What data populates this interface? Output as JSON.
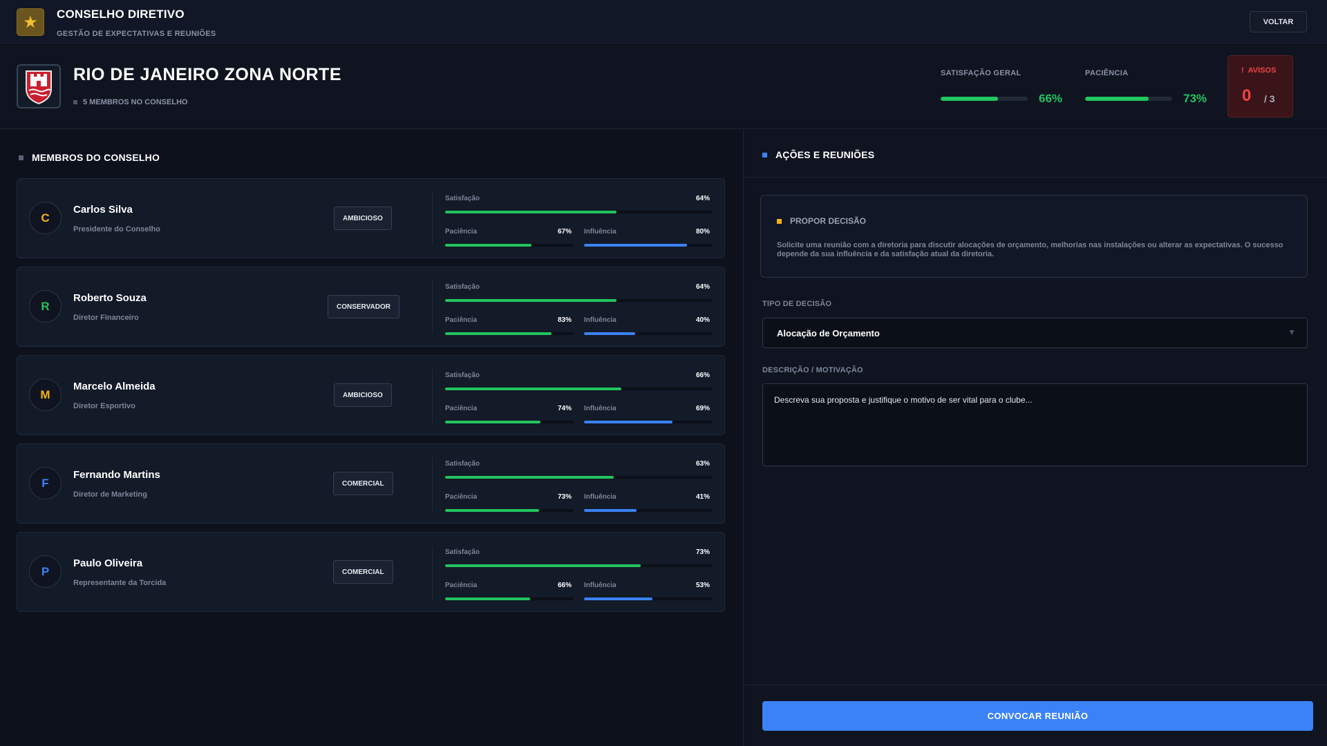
{
  "app": {
    "title": "CONSELHO DIRETIVO",
    "subtitle": "GESTÃO DE EXPECTATIVAS E REUNIÕES",
    "back_label": "VOLTAR",
    "logo_icon": "star-icon"
  },
  "club": {
    "name": "RIO DE JANEIRO ZONA NORTE",
    "members_count_label": "5 MEMBROS NO CONSELHO",
    "crest_icon": "castle-crest-icon",
    "overall_satisfaction": {
      "label": "SATISFAÇÃO GERAL",
      "value": 66,
      "display": "66%"
    },
    "patience": {
      "label": "PACIÊNCIA",
      "value": 73,
      "display": "73%"
    },
    "warnings": {
      "label": "AVISOS",
      "count": "0",
      "max": "/ 3"
    }
  },
  "members_section": {
    "title": "MEMBROS DO CONSELHO",
    "labels": {
      "satisfaction": "Satisfação",
      "patience": "Paciência",
      "influence": "Influência"
    },
    "members": [
      {
        "initial": "C",
        "name": "Carlos Silva",
        "role": "Presidente do Conselho",
        "trait": "AMBICIOSO",
        "color": "#f5b313",
        "satisfaction": 64,
        "satisfaction_display": "64%",
        "patience": 67,
        "patience_display": "67%",
        "influence": 80,
        "influence_display": "80%"
      },
      {
        "initial": "R",
        "name": "Roberto Souza",
        "role": "Diretor Financeiro",
        "trait": "CONSERVADOR",
        "color": "#22c55e",
        "satisfaction": 64,
        "satisfaction_display": "64%",
        "patience": 83,
        "patience_display": "83%",
        "influence": 40,
        "influence_display": "40%"
      },
      {
        "initial": "M",
        "name": "Marcelo Almeida",
        "role": "Diretor Esportivo",
        "trait": "AMBICIOSO",
        "color": "#f5b313",
        "satisfaction": 66,
        "satisfaction_display": "66%",
        "patience": 74,
        "patience_display": "74%",
        "influence": 69,
        "influence_display": "69%"
      },
      {
        "initial": "F",
        "name": "Fernando Martins",
        "role": "Diretor de Marketing",
        "trait": "COMERCIAL",
        "color": "#3b82f6",
        "satisfaction": 63,
        "satisfaction_display": "63%",
        "patience": 73,
        "patience_display": "73%",
        "influence": 41,
        "influence_display": "41%"
      },
      {
        "initial": "P",
        "name": "Paulo Oliveira",
        "role": "Representante da Torcida",
        "trait": "COMERCIAL",
        "color": "#3b82f6",
        "satisfaction": 73,
        "satisfaction_display": "73%",
        "patience": 66,
        "patience_display": "66%",
        "influence": 53,
        "influence_display": "53%"
      }
    ]
  },
  "actions": {
    "title": "AÇÕES E REUNIÕES",
    "propose": {
      "title": "PROPOR DECISÃO",
      "text": "Solicite uma reunião com a diretoria para discutir alocações de orçamento, melhorias nas instalações ou alterar as expectativas. O sucesso depende da sua influência e da satisfação atual da diretoria."
    },
    "decision_type": {
      "label": "TIPO DE DECISÃO",
      "value": "Alocação de Orçamento"
    },
    "description": {
      "label": "DESCRIÇÃO / MOTIVAÇÃO",
      "placeholder": "Descreva sua proposta e justifique o motivo de ser vital para o clube..."
    },
    "convene_label": "CONVOCAR REUNIÃO"
  },
  "colors": {
    "accent_blue": "#3b82f6",
    "success_green": "#22c55e",
    "warning_amber": "#f5b313",
    "danger_red": "#ef4444"
  }
}
